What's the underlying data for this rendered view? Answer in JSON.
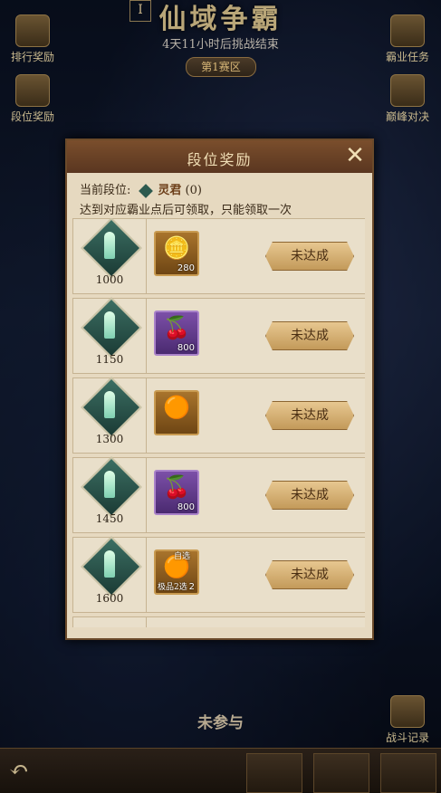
{
  "header": {
    "title": "仙域争霸",
    "countdown": "4天11小时后挑战结束",
    "season": "第1赛区",
    "marker": "I"
  },
  "side_buttons": {
    "ranking_reward": "排行奖励",
    "tier_reward": "段位奖励",
    "hegemony_task": "霸业任务",
    "final_battle": "巅峰对决",
    "battle_record": "战斗记录"
  },
  "status": {
    "not_joined": "未参与"
  },
  "dialog": {
    "title": "段位奖励",
    "close": "✕",
    "current_rank_label": "当前段位:",
    "current_rank_name": "灵君",
    "current_rank_points": "(0)",
    "rule": "达到对应霸业点后可领取，只能领取一次",
    "rows": [
      {
        "points": "1000",
        "item_icon": "gold-ingot-icon",
        "item_count": "280",
        "button": "未达成"
      },
      {
        "points": "1150",
        "item_icon": "fruit-icon",
        "item_count": "800",
        "button": "未达成"
      },
      {
        "points": "1300",
        "item_icon": "pill-orb-icon",
        "item_count": "",
        "button": "未达成"
      },
      {
        "points": "1450",
        "item_icon": "fruit-icon",
        "item_count": "800",
        "button": "未达成"
      },
      {
        "points": "1600",
        "item_icon": "choice-pill-icon",
        "item_count": "2",
        "item_tag_top": "自选",
        "item_tag_bottom": "极品2选",
        "button": "未达成"
      }
    ]
  },
  "colors": {
    "dialog_bg": "#e6d9c0",
    "header_brown": "#6a4226",
    "button_gold": "#d9b57a",
    "gold_item": "#8d5a1e",
    "purple_item": "#6a3f94"
  }
}
